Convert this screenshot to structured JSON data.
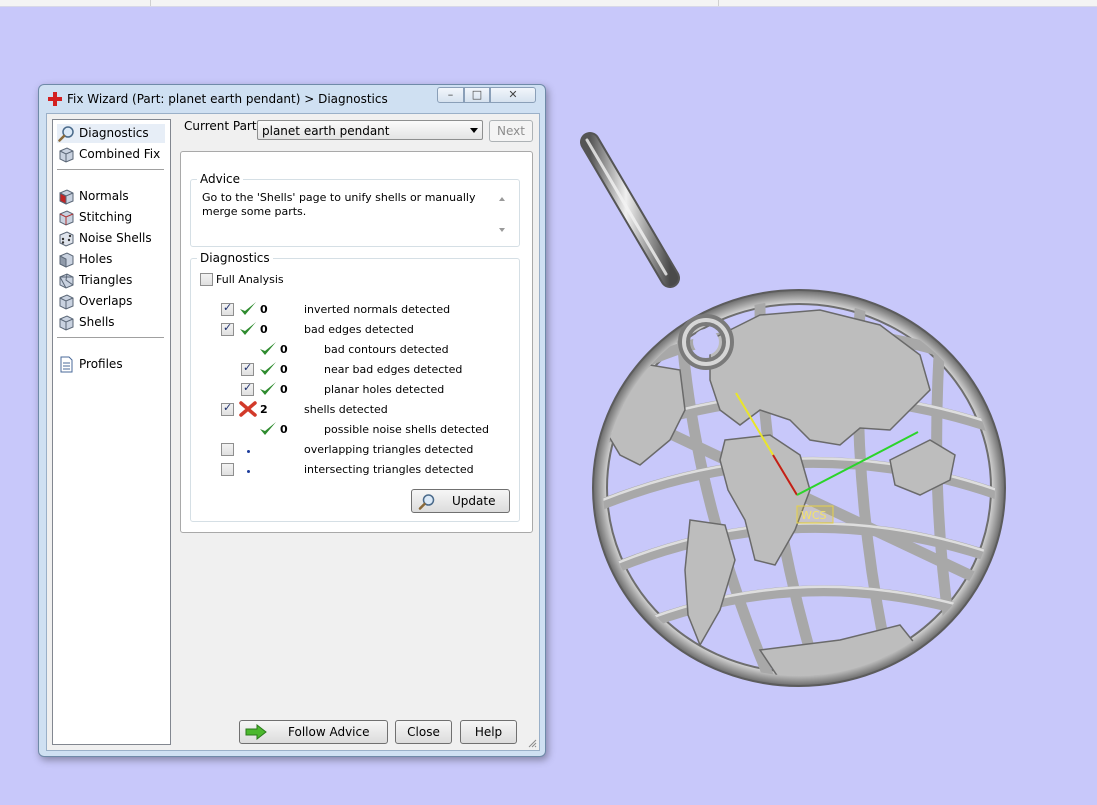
{
  "window": {
    "title": "Fix Wizard (Part: planet earth pendant) > Diagnostics"
  },
  "nav": {
    "groups": [
      [
        {
          "label": "Diagnostics",
          "icon": "magnifier-icon"
        },
        {
          "label": "Combined Fix",
          "icon": "cube-icon"
        }
      ],
      [
        {
          "label": "Normals",
          "icon": "cube-red-face-icon"
        },
        {
          "label": "Stitching",
          "icon": "cube-icon"
        },
        {
          "label": "Noise Shells",
          "icon": "dice-icon"
        },
        {
          "label": "Holes",
          "icon": "cube-icon"
        },
        {
          "label": "Triangles",
          "icon": "cube-triangles-icon"
        },
        {
          "label": "Overlaps",
          "icon": "cube-icon"
        },
        {
          "label": "Shells",
          "icon": "cube-icon"
        }
      ],
      [
        {
          "label": "Profiles",
          "icon": "document-icon"
        }
      ]
    ],
    "selected": "Diagnostics"
  },
  "current_part": {
    "label": "Current Part:",
    "value": "planet earth pendant"
  },
  "next_button": "Next",
  "advice": {
    "title": "Advice",
    "text": "Go to the 'Shells' page to unify shells or manually merge some parts."
  },
  "diagnostics": {
    "title": "Diagnostics",
    "full_analysis_label": "Full Analysis",
    "rows": [
      {
        "checkbox": true,
        "checked": true,
        "status": "ok",
        "count": "0",
        "label": "inverted normals detected",
        "indent": 0
      },
      {
        "checkbox": true,
        "checked": true,
        "status": "ok",
        "count": "0",
        "label": "bad edges detected",
        "indent": 0
      },
      {
        "checkbox": false,
        "checked": false,
        "status": "ok",
        "count": "0",
        "label": "bad contours detected",
        "indent": 1
      },
      {
        "checkbox": true,
        "checked": true,
        "status": "ok",
        "count": "0",
        "label": "near bad edges detected",
        "indent": 1
      },
      {
        "checkbox": true,
        "checked": true,
        "status": "ok",
        "count": "0",
        "label": "planar holes detected",
        "indent": 1
      },
      {
        "checkbox": true,
        "checked": true,
        "status": "error",
        "count": "2",
        "label": "shells detected",
        "indent": 0
      },
      {
        "checkbox": false,
        "checked": false,
        "status": "ok",
        "count": "0",
        "label": "possible noise shells detected",
        "indent": 1
      },
      {
        "checkbox": true,
        "checked": false,
        "status": "pending",
        "count": "",
        "label": "overlapping triangles detected",
        "indent": 0
      },
      {
        "checkbox": true,
        "checked": false,
        "status": "pending",
        "count": "",
        "label": "intersecting triangles detected",
        "indent": 0
      }
    ],
    "update_button": "Update"
  },
  "footer": {
    "follow_advice": "Follow Advice",
    "close": "Close",
    "help": "Help"
  },
  "viewport": {
    "axis_label": "WCS"
  },
  "colors": {
    "ok": "#2e8b2e",
    "error": "#d23a2a",
    "background": "#c8c8fa"
  }
}
